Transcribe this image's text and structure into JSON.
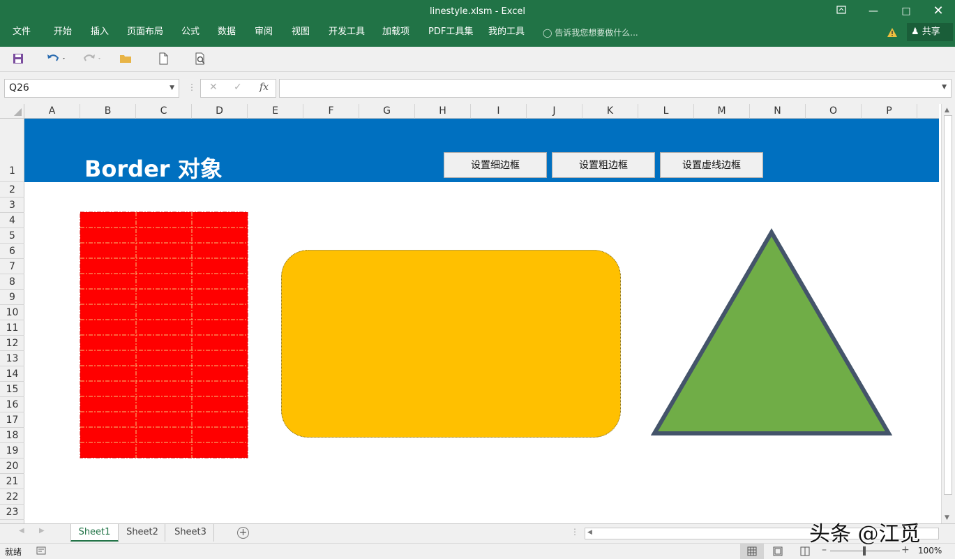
{
  "window": {
    "title": "linestyle.xlsm - Excel"
  },
  "menu": [
    "文件",
    "开始",
    "插入",
    "页面布局",
    "公式",
    "数据",
    "审阅",
    "视图",
    "开发工具",
    "加载项",
    "PDF工具集",
    "我的工具"
  ],
  "tell_me": "告诉我您想要做什么...",
  "share_label": "共享",
  "name_box": "Q26",
  "fx_label": "fx",
  "formula": "",
  "columns": [
    "A",
    "B",
    "C",
    "D",
    "E",
    "F",
    "G",
    "H",
    "I",
    "J",
    "K",
    "L",
    "M",
    "N",
    "O",
    "P"
  ],
  "rows": [
    "1",
    "2",
    "3",
    "4",
    "5",
    "6",
    "7",
    "8",
    "9",
    "10",
    "11",
    "12",
    "13",
    "14",
    "15",
    "16",
    "17",
    "18",
    "19",
    "20",
    "21",
    "22",
    "23"
  ],
  "sheet_title": "Border 对象",
  "buttons": [
    "设置细边框",
    "设置粗边框",
    "设置虚线边框"
  ],
  "sheets": [
    "Sheet1",
    "Sheet2",
    "Sheet3"
  ],
  "status": {
    "ready": "就绪",
    "zoom": "100%"
  },
  "watermark": "头条 @江觅",
  "colors": {
    "ribbon": "#217346",
    "banner": "#0070c0",
    "red_range": "#ff0000",
    "rounded_rect": "#ffc000",
    "triangle_fill": "#70ad47",
    "triangle_border": "#44546a"
  }
}
